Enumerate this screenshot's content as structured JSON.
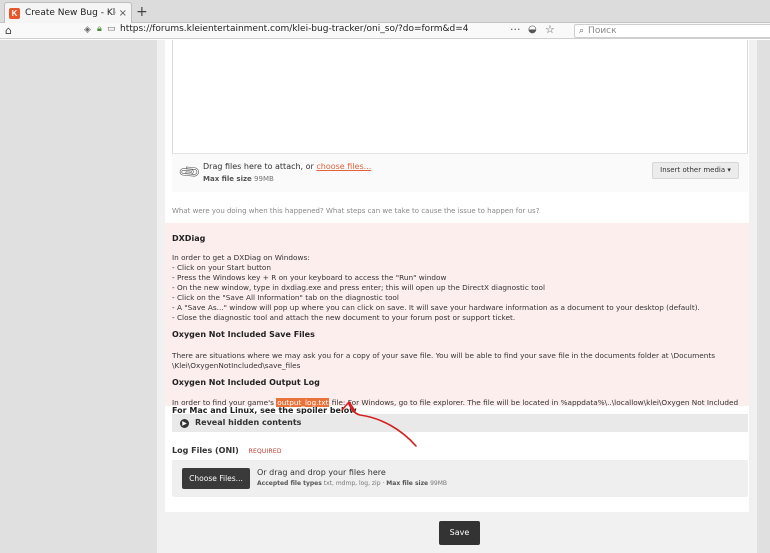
{
  "browser": {
    "tab_title": "Create New Bug - Klei En",
    "tab_favicon": "K",
    "tab_close": "×",
    "new_tab": "+",
    "url": "https://forums.kleientertainment.com/klei-bug-tracker/oni_so/?do=form&d=4",
    "search_placeholder": "Поиск",
    "more_glyph": "···"
  },
  "attach": {
    "drag_text": "Drag files here to attach, or",
    "choose_link": "choose files...",
    "max_label": "Max file size",
    "max_value": "99MB",
    "insert_button": "Insert other media ▾"
  },
  "question": "What were you doing when this happened? What steps can we take to cause the issue to happen for us?",
  "info": {
    "dxdiag_heading": "DXDiag",
    "dxdiag_lines": [
      "In order to get a DXDiag on Windows:",
      "- Click on your Start button",
      "- Press the Windows key + R on your keyboard to access the \"Run\" window",
      "- On the new window, type in dxdiag.exe and press enter; this will open up the DirectX diagnostic tool",
      "- Click on the \"Save All Information\" tab on the diagnostic tool",
      "- A \"Save As...\" window will pop up where you can click on save. It will save your hardware information as a document to your desktop (default).",
      "- Close the diagnostic tool and attach the new document to your forum post or support ticket."
    ],
    "save_heading": "Oxygen Not Included Save Files",
    "save_line1": "There are situations where we may ask you for a copy of your save file. You will be able to find your save file in the documents folder at \\Documents",
    "save_line2": "\\Klei\\OxygenNotIncluded\\save_files",
    "log_heading": "Oxygen Not Included Output Log",
    "log_pre": "In order to find your game's",
    "log_highlight": "output_log.txt",
    "log_post": "file: For Windows, go to file explorer. The file will be located in %appdata%\\..\\locallow\\klei\\Oxygen Not Included"
  },
  "spoiler": {
    "label": "For Mac and Linux, see the spoiler below",
    "reveal": "Reveal hidden contents"
  },
  "logfiles": {
    "label": "Log Files (ONI)",
    "required": "REQUIRED",
    "choose_button": "Choose Files...",
    "drop_text": "Or drag and drop your files here",
    "accepted_label": "Accepted file types",
    "accepted_value": "txt, mdmp, log, zip",
    "max_label": "Max file size",
    "max_value": "99MB"
  },
  "save_button": "Save",
  "colors": {
    "accent": "#e8733a",
    "link": "#e0623c",
    "annotation": "#d42020",
    "info_bg": "#fdeeee"
  }
}
